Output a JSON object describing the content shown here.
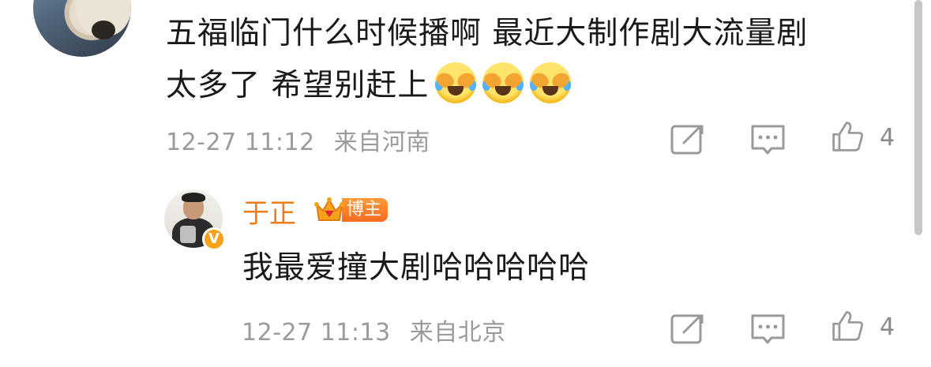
{
  "comment": {
    "text_line1": "五福临门什么时候播啊 最近大制作剧大流量剧",
    "text_line2": "太多了 希望别赶上",
    "emoji_icons": [
      "laugh-cry-emoji",
      "laugh-cry-emoji",
      "laugh-cry-emoji"
    ],
    "time": "12-27 11:12",
    "location": "来自河南",
    "like_count": "4"
  },
  "reply": {
    "author": "于正",
    "author_badge": "博主",
    "verified_icon": "v-badge-icon",
    "text": "我最爱撞大剧哈哈哈哈哈",
    "time": "12-27 11:13",
    "location": "来自北京",
    "like_count": "4"
  },
  "colors": {
    "name_orange": "#ef7d1a",
    "meta_gray": "#9b9b9b",
    "badge_orange": "#f56b20"
  }
}
